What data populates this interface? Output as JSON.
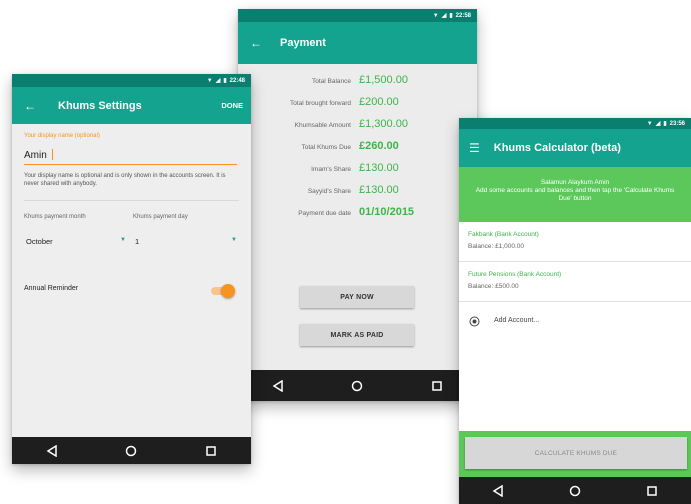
{
  "colors": {
    "status": "#0a7f70",
    "appbar": "#13a38f",
    "accent": "#f7931e",
    "green_text": "#3cb54a",
    "banner": "#5cc85c",
    "navbar": "#1e1e1e"
  },
  "settings": {
    "status_time": "22:48",
    "back_icon": "arrow-left-icon",
    "title": "Khums Settings",
    "done": "DONE",
    "name_label": "Your display name (optional)",
    "name_value": "Amin",
    "name_help": "Your display name is optional and is only shown in the accounts screen. It is never shared with anybody.",
    "month_label": "Khums payment month",
    "day_label": "Khums payment day",
    "month_value": "October",
    "day_value": "1",
    "reminder_label": "Annual Reminder",
    "reminder_on": true
  },
  "payment": {
    "status_time": "22:58",
    "back_icon": "arrow-left-icon",
    "title": "Payment",
    "rows": [
      {
        "label": "Total Balance",
        "value": "£1,500.00",
        "bold": false
      },
      {
        "label": "Total brought forward",
        "value": "£200.00",
        "bold": false
      },
      {
        "label": "Khumsable Amount",
        "value": "£1,300.00",
        "bold": false
      },
      {
        "label": "Total Khums Due",
        "value": "£260.00",
        "bold": true
      },
      {
        "label": "Imam's Share",
        "value": "£130.00",
        "bold": false
      },
      {
        "label": "Sayyid's Share",
        "value": "£130.00",
        "bold": false
      },
      {
        "label": "Payment due date",
        "value": "01/10/2015",
        "bold": true
      }
    ],
    "pay_now": "PAY NOW",
    "mark_paid": "MARK AS PAID"
  },
  "calculator": {
    "status_time": "23:56",
    "menu_icon": "hamburger-menu-icon",
    "title": "Khums Calculator (beta)",
    "banner_line1": "Salamun Alaykum Amin",
    "banner_line2": "Add some accounts and balances and then tap the 'Calculate Khums Due' button",
    "accounts": [
      {
        "name": "Fakbank (Bank Account)",
        "balance": "Balance: £1,000.00"
      },
      {
        "name": "Future Pensions (Bank Account)",
        "balance": "Balance: £500.00"
      }
    ],
    "add_account": "Add Account...",
    "calculate": "CALCULATE KHUMS DUE"
  },
  "navbar_icons": [
    "back-triangle-icon",
    "home-circle-icon",
    "recents-square-icon"
  ]
}
